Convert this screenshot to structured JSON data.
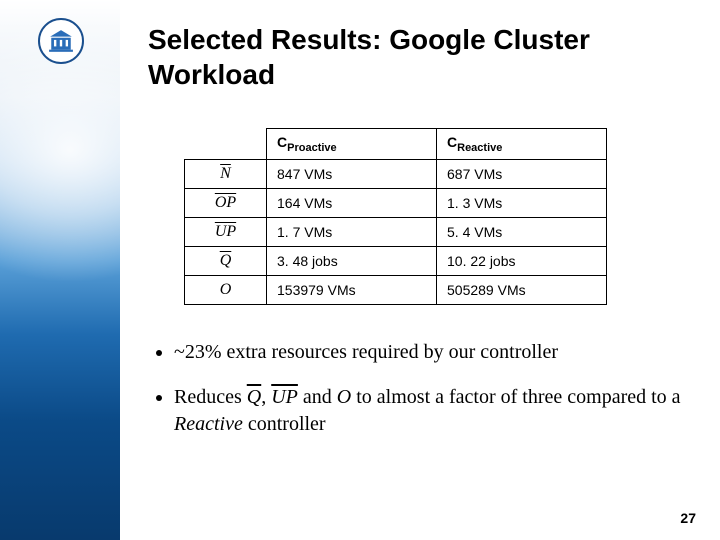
{
  "title": "Selected Results: Google Cluster Workload",
  "pagenum": "27",
  "table": {
    "headers": {
      "blank": "",
      "col1": "Proactive",
      "col2": "Reactive"
    },
    "rows": [
      {
        "label": "N",
        "overline": true,
        "a": "847 VMs",
        "b": "687 VMs"
      },
      {
        "label": "OP",
        "overline": true,
        "a": "164 VMs",
        "b": "1. 3 VMs"
      },
      {
        "label": "UP",
        "overline": true,
        "a": "1. 7 VMs",
        "b": "5. 4 VMs"
      },
      {
        "label": "Q",
        "overline": true,
        "a": "3. 48 jobs",
        "b": "10. 22 jobs"
      },
      {
        "label": "O",
        "overline": false,
        "a": "153979 VMs",
        "b": "505289 VMs"
      }
    ]
  },
  "bullets": {
    "b1_pre": "~23% extra resources required by our controller",
    "b2_pre": "Reduces ",
    "b2_q": "Q",
    "b2_sep1": ", ",
    "b2_up": "UP",
    "b2_sep2": " and ",
    "b2_o": "O",
    "b2_post": " to almost a factor of three compared to a ",
    "b2_reactive": "Reactive",
    "b2_tail": " controller"
  }
}
